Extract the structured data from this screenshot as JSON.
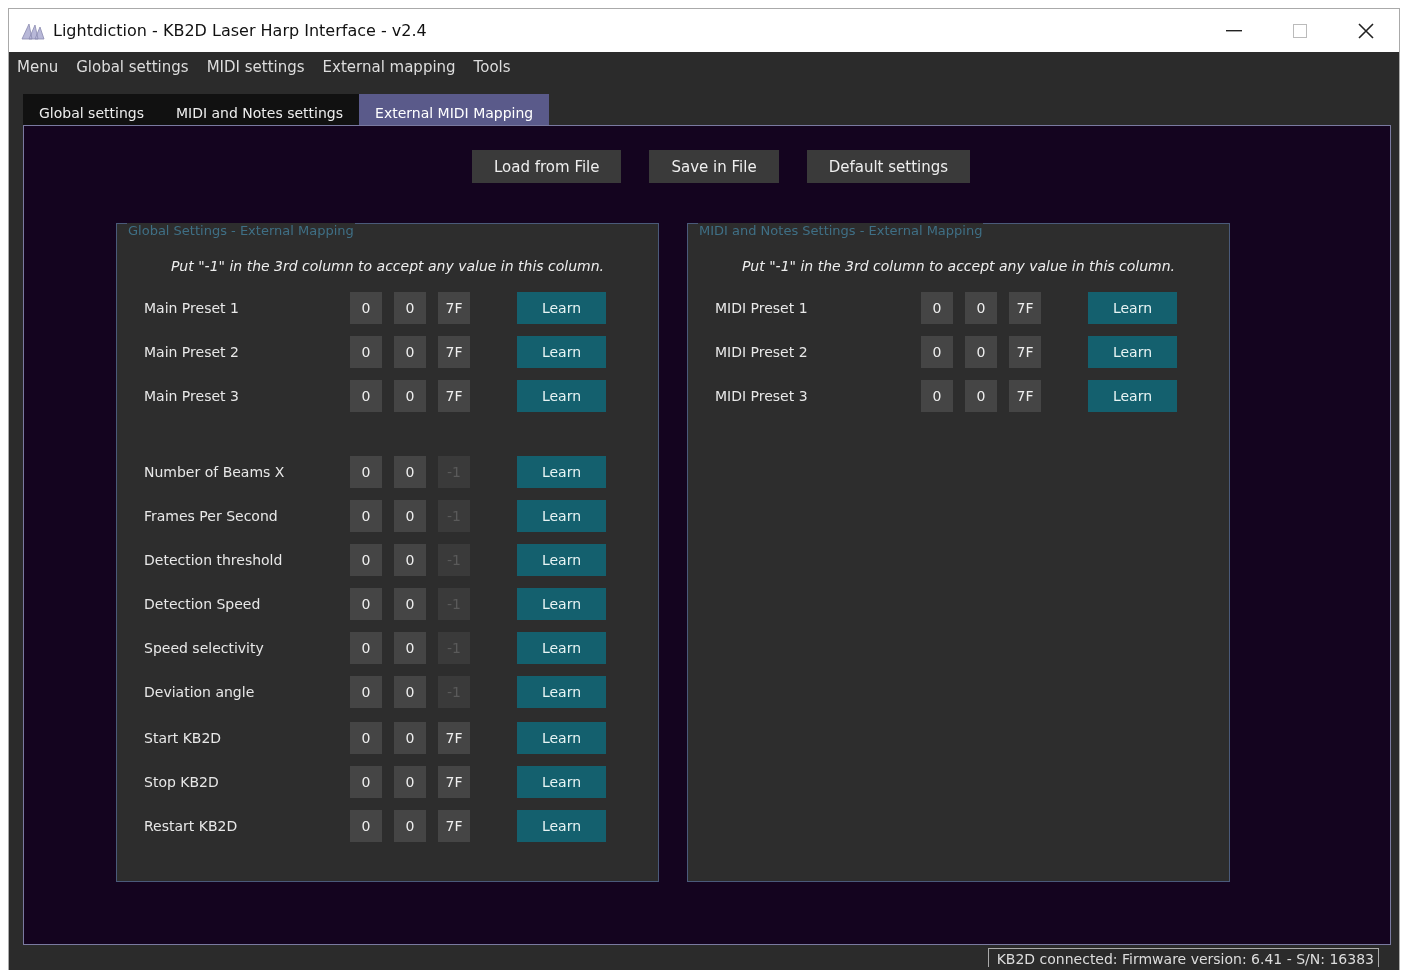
{
  "window": {
    "title": "Lightdiction - KB2D Laser Harp Interface - v2.4"
  },
  "menu": [
    "Menu",
    "Global settings",
    "MIDI settings",
    "External mapping",
    "Tools"
  ],
  "tabs": [
    {
      "label": "Global settings",
      "selected": false
    },
    {
      "label": "MIDI and Notes settings",
      "selected": false
    },
    {
      "label": "External MIDI Mapping",
      "selected": true
    }
  ],
  "buttons": [
    "Load from File",
    "Save in File",
    "Default settings"
  ],
  "panels": [
    {
      "title": "Global Settings - External Mapping",
      "hint": "Put \"-1\" in the 3rd column to accept any value in this column.",
      "groups": [
        [
          {
            "label": "Main Preset 1",
            "fields": [
              {
                "value": "0",
                "disabled": false
              },
              {
                "value": "0",
                "disabled": false
              },
              {
                "value": "7F",
                "disabled": false
              }
            ],
            "button": "Learn"
          },
          {
            "label": "Main Preset 2",
            "fields": [
              {
                "value": "0",
                "disabled": false
              },
              {
                "value": "0",
                "disabled": false
              },
              {
                "value": "7F",
                "disabled": false
              }
            ],
            "button": "Learn"
          },
          {
            "label": "Main Preset 3",
            "fields": [
              {
                "value": "0",
                "disabled": false
              },
              {
                "value": "0",
                "disabled": false
              },
              {
                "value": "7F",
                "disabled": false
              }
            ],
            "button": "Learn"
          }
        ],
        [
          {
            "label": "Number of Beams X",
            "fields": [
              {
                "value": "0",
                "disabled": false
              },
              {
                "value": "0",
                "disabled": false
              },
              {
                "value": "-1",
                "disabled": true
              }
            ],
            "button": "Learn"
          },
          {
            "label": "Frames Per Second",
            "fields": [
              {
                "value": "0",
                "disabled": false
              },
              {
                "value": "0",
                "disabled": false
              },
              {
                "value": "-1",
                "disabled": true
              }
            ],
            "button": "Learn"
          },
          {
            "label": "Detection threshold",
            "fields": [
              {
                "value": "0",
                "disabled": false
              },
              {
                "value": "0",
                "disabled": false
              },
              {
                "value": "-1",
                "disabled": true
              }
            ],
            "button": "Learn"
          },
          {
            "label": "Detection Speed",
            "fields": [
              {
                "value": "0",
                "disabled": false
              },
              {
                "value": "0",
                "disabled": false
              },
              {
                "value": "-1",
                "disabled": true
              }
            ],
            "button": "Learn"
          },
          {
            "label": "Speed selectivity",
            "fields": [
              {
                "value": "0",
                "disabled": false
              },
              {
                "value": "0",
                "disabled": false
              },
              {
                "value": "-1",
                "disabled": true
              }
            ],
            "button": "Learn"
          },
          {
            "label": "Deviation angle",
            "fields": [
              {
                "value": "0",
                "disabled": false
              },
              {
                "value": "0",
                "disabled": false
              },
              {
                "value": "-1",
                "disabled": true
              }
            ],
            "button": "Learn"
          }
        ],
        [
          {
            "label": "Start KB2D",
            "fields": [
              {
                "value": "0",
                "disabled": false
              },
              {
                "value": "0",
                "disabled": false
              },
              {
                "value": "7F",
                "disabled": false
              }
            ],
            "button": "Learn"
          },
          {
            "label": "Stop KB2D",
            "fields": [
              {
                "value": "0",
                "disabled": false
              },
              {
                "value": "0",
                "disabled": false
              },
              {
                "value": "7F",
                "disabled": false
              }
            ],
            "button": "Learn"
          },
          {
            "label": "Restart KB2D",
            "fields": [
              {
                "value": "0",
                "disabled": false
              },
              {
                "value": "0",
                "disabled": false
              },
              {
                "value": "7F",
                "disabled": false
              }
            ],
            "button": "Learn"
          }
        ]
      ]
    },
    {
      "title": "MIDI and Notes Settings - External Mapping",
      "hint": "Put \"-1\" in the 3rd column to accept any value in this column.",
      "groups": [
        [
          {
            "label": "MIDI Preset 1",
            "fields": [
              {
                "value": "0",
                "disabled": false
              },
              {
                "value": "0",
                "disabled": false
              },
              {
                "value": "7F",
                "disabled": false
              }
            ],
            "button": "Learn"
          },
          {
            "label": "MIDI Preset 2",
            "fields": [
              {
                "value": "0",
                "disabled": false
              },
              {
                "value": "0",
                "disabled": false
              },
              {
                "value": "7F",
                "disabled": false
              }
            ],
            "button": "Learn"
          },
          {
            "label": "MIDI Preset 3",
            "fields": [
              {
                "value": "0",
                "disabled": false
              },
              {
                "value": "0",
                "disabled": false
              },
              {
                "value": "7F",
                "disabled": false
              }
            ],
            "button": "Learn"
          }
        ]
      ]
    }
  ],
  "status_bar": "KB2D connected: Firmware version: 6.41 - S/N: 16383"
}
